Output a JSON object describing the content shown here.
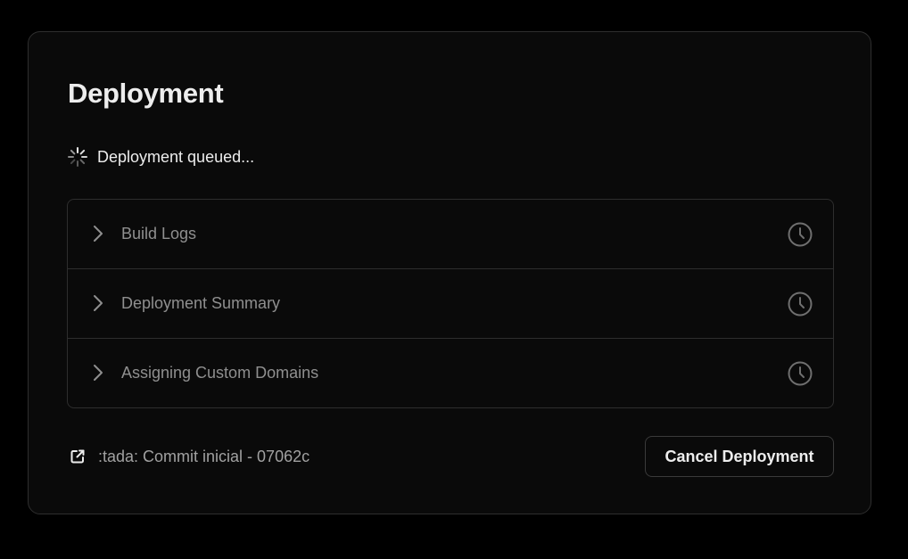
{
  "card": {
    "title": "Deployment",
    "status": {
      "icon": "spinner-icon",
      "text": "Deployment queued..."
    },
    "steps": [
      {
        "label": "Build Logs",
        "icon": "clock-icon"
      },
      {
        "label": "Deployment Summary",
        "icon": "clock-icon"
      },
      {
        "label": "Assigning Custom Domains",
        "icon": "clock-icon"
      }
    ],
    "commit": {
      "icon": "external-link-icon",
      "text": ":tada: Commit inicial - 07062c"
    },
    "cancel_label": "Cancel Deployment"
  },
  "colors": {
    "background": "#000000",
    "card": "#0a0a0a",
    "border": "#2e2e2e",
    "text_primary": "#ededed",
    "text_muted": "#8f8f8f"
  }
}
